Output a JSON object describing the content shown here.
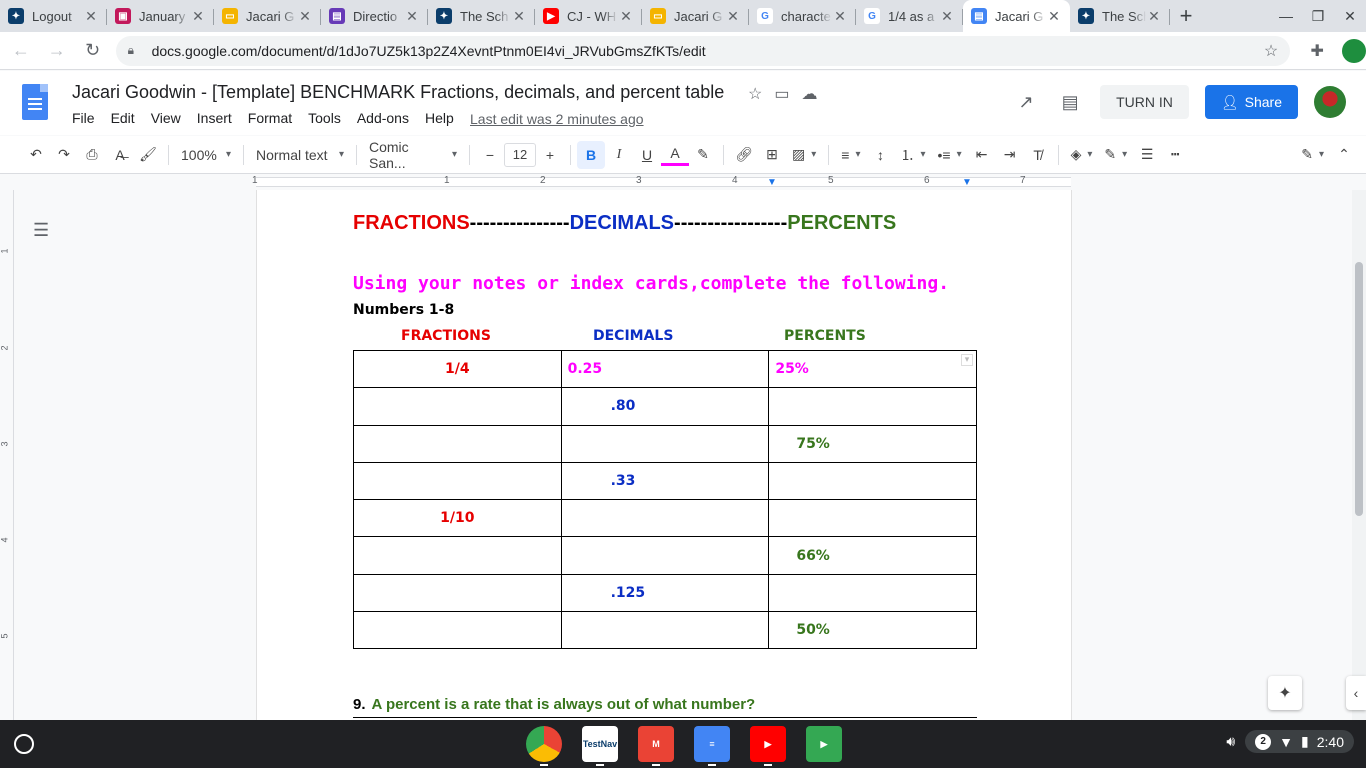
{
  "browser": {
    "tabs": [
      {
        "title": "Logout",
        "color": "#0b3d6b",
        "glyph": "✦"
      },
      {
        "title": "January",
        "color": "#c2185b",
        "glyph": "▣"
      },
      {
        "title": "Jacari G",
        "color": "#f4b400",
        "glyph": "▭"
      },
      {
        "title": "Directio",
        "color": "#673ab7",
        "glyph": "▤"
      },
      {
        "title": "The Sch",
        "color": "#0b3d6b",
        "glyph": "✦"
      },
      {
        "title": "CJ - WH",
        "color": "#ff0000",
        "glyph": "▶"
      },
      {
        "title": "Jacari G",
        "color": "#f4b400",
        "glyph": "▭"
      },
      {
        "title": "characte",
        "color": "#ffffff",
        "glyph": "G"
      },
      {
        "title": "1/4 as a",
        "color": "#ffffff",
        "glyph": "G"
      },
      {
        "title": "Jacari G",
        "color": "#4285f4",
        "glyph": "▤",
        "active": true
      },
      {
        "title": "The Sch",
        "color": "#0b3d6b",
        "glyph": "✦"
      }
    ],
    "url": "docs.google.com/document/d/1dJo7UZ5k13p2Z4XevntPtnm0EI4vi_JRVubGmsZfKTs/edit"
  },
  "docs": {
    "title": "Jacari Goodwin - [Template] BENCHMARK Fractions, decimals, and percent table",
    "menu": [
      "File",
      "Edit",
      "View",
      "Insert",
      "Format",
      "Tools",
      "Add-ons",
      "Help"
    ],
    "last_edit": "Last edit was 2 minutes ago",
    "turn_in": "TURN IN",
    "share": "Share",
    "toolbar": {
      "zoom": "100%",
      "style": "Normal text",
      "font": "Comic San...",
      "font_size": "12"
    }
  },
  "ruler": {
    "h": [
      "1",
      "1",
      "2",
      "3",
      "4",
      "5",
      "6",
      "7"
    ],
    "v": [
      "1",
      "2",
      "3",
      "4",
      "5"
    ]
  },
  "document": {
    "heading": {
      "fractions": "FRACTIONS",
      "dashes1": "---------------",
      "decimals": "DECIMALS",
      "dashes2": "-----------------",
      "percents": "PERCENTS"
    },
    "instruction": "Using your notes or index cards,complete the following.",
    "numbers_label": "Numbers 1-8",
    "column_headers": {
      "fractions": "FRACTIONS",
      "decimals": "DECIMALS",
      "percents": "PERCENTS"
    },
    "rows": [
      {
        "fraction": "1/4",
        "decimal": "0.25",
        "percent": "25%"
      },
      {
        "fraction": "",
        "decimal": ".80",
        "percent": ""
      },
      {
        "fraction": "",
        "decimal": "",
        "percent": "75%"
      },
      {
        "fraction": "",
        "decimal": ".33",
        "percent": ""
      },
      {
        "fraction": "1/10",
        "decimal": "",
        "percent": ""
      },
      {
        "fraction": "",
        "decimal": "",
        "percent": "66%"
      },
      {
        "fraction": "",
        "decimal": ".125",
        "percent": ""
      },
      {
        "fraction": "",
        "decimal": "",
        "percent": "50%"
      }
    ],
    "q9_number": "9.",
    "q9_text": "A percent is a rate that is always out of what number?"
  },
  "shelf": {
    "apps": [
      {
        "name": "chrome",
        "color": "#4285f4",
        "label": ""
      },
      {
        "name": "testnav",
        "color": "#ffffff",
        "label": "TestNav"
      },
      {
        "name": "gmail",
        "color": "#ea4335",
        "label": "M"
      },
      {
        "name": "docs",
        "color": "#4285f4",
        "label": "≡"
      },
      {
        "name": "youtube",
        "color": "#ff0000",
        "label": "▶"
      },
      {
        "name": "play",
        "color": "#34a853",
        "label": "▶"
      }
    ],
    "notifications": "2",
    "clock": "2:40"
  }
}
